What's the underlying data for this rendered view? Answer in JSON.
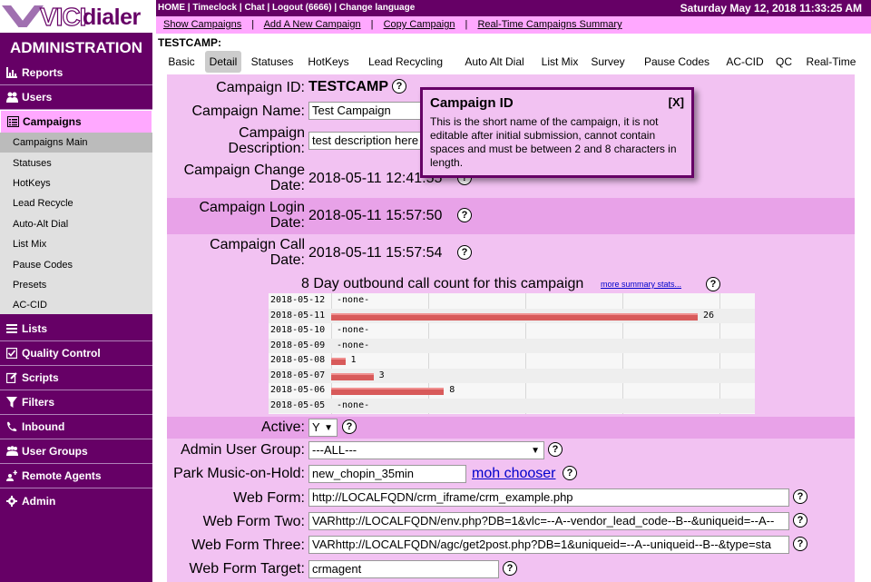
{
  "logo": {
    "vici": "VICI",
    "dialer": "dialer"
  },
  "sidebar": {
    "title": "ADMINISTRATION",
    "items": [
      {
        "label": "Reports",
        "icon": "bar-chart-icon"
      },
      {
        "label": "Users",
        "icon": "users-icon"
      },
      {
        "label": "Campaigns",
        "icon": "list-icon"
      },
      {
        "label": "Lists",
        "icon": "lines-icon"
      },
      {
        "label": "Quality Control",
        "icon": "checkbox-icon"
      },
      {
        "label": "Scripts",
        "icon": "edit-icon"
      },
      {
        "label": "Filters",
        "icon": "funnel-icon"
      },
      {
        "label": "Inbound",
        "icon": "phone-icon"
      },
      {
        "label": "User Groups",
        "icon": "group-icon"
      },
      {
        "label": "Remote Agents",
        "icon": "remote-agent-icon"
      },
      {
        "label": "Admin",
        "icon": "gear-icon"
      }
    ],
    "campaign_subitems": [
      "Campaigns Main",
      "Statuses",
      "HotKeys",
      "Lead Recycle",
      "Auto-Alt Dial",
      "List Mix",
      "Pause Codes",
      "Presets",
      "AC-CID"
    ]
  },
  "topbar": {
    "links": "HOME | Timeclock | Chat | Logout (6666) | Change language",
    "datetime": "Saturday May 12, 2018 11:33:25 AM"
  },
  "subtop": {
    "show_campaigns": "Show Campaigns",
    "add_campaign": "Add A New Campaign",
    "copy_campaign": "Copy Campaign",
    "realtime_summary": "Real-Time Campaigns Summary",
    "sep": "|"
  },
  "campaign_code": "TESTCAMP:",
  "tabs": [
    "Basic",
    "Detail",
    "Statuses",
    "HotKeys",
    "Lead Recycling",
    "Auto Alt Dial",
    "List Mix",
    "Survey",
    "Pause Codes",
    "AC-CID",
    "QC",
    "Real-Time"
  ],
  "form": {
    "campaign_id_label": "Campaign ID:",
    "campaign_id_value": "TESTCAMP",
    "campaign_name_label": "Campaign Name:",
    "campaign_name_value": "Test Campaign",
    "campaign_desc_label_1": "Campaign",
    "campaign_desc_label_2": "Description:",
    "campaign_desc_value": "test description here",
    "change_date_label_1": "Campaign Change",
    "change_date_label_2": "Date:",
    "change_date_value": "2018-05-11 12:41:55",
    "login_date_label_1": "Campaign Login",
    "login_date_label_2": "Date:",
    "login_date_value": "2018-05-11 15:57:50",
    "call_date_label_1": "Campaign Call",
    "call_date_label_2": "Date:",
    "call_date_value": "2018-05-11 15:57:54",
    "chart_title": "8 Day outbound call count for this campaign",
    "more_stats": "more summary stats...",
    "active_label": "Active:",
    "active_value": "Y",
    "admin_group_label": "Admin User Group:",
    "admin_group_value": "---ALL---",
    "park_music_label": "Park Music-on-Hold:",
    "park_music_value": "new_chopin_35min",
    "moh_chooser": "moh chooser",
    "web_form_label": "Web Form:",
    "web_form_value": "http://LOCALFQDN/crm_iframe/crm_example.php",
    "web_form_two_label": "Web Form Two:",
    "web_form_two_value": "VARhttp://LOCALFQDN/env.php?DB=1&vlc=--A--vendor_lead_code--B--&uniqueid=--A--",
    "web_form_three_label": "Web Form Three:",
    "web_form_three_value": "VARhttp://LOCALFQDN/agc/get2post.php?DB=1&uniqueid=--A--uniqueid--B--&type=sta",
    "web_form_target_label": "Web Form Target:",
    "web_form_target_value": "crmagent",
    "help_glyph": "?"
  },
  "tooltip": {
    "title": "Campaign ID",
    "close": "[X]",
    "body": "This is the short name of the campaign, it is not editable after initial submission, cannot contain spaces and must be between 2 and 8 characters in length."
  },
  "chart_data": {
    "type": "bar",
    "orientation": "horizontal",
    "title": "8 Day outbound call count for this campaign",
    "categories": [
      "2018-05-12",
      "2018-05-11",
      "2018-05-10",
      "2018-05-09",
      "2018-05-08",
      "2018-05-07",
      "2018-05-06",
      "2018-05-05"
    ],
    "values": [
      null,
      26,
      null,
      null,
      1,
      3,
      8,
      null
    ],
    "empty_label": "-none-",
    "bar_color": "#d85a5a"
  }
}
